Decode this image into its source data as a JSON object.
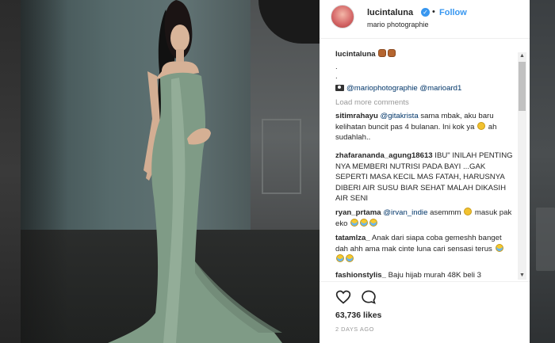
{
  "post": {
    "username": "lucintaluna",
    "follow_label": "Follow",
    "separator": "•",
    "location": "mario photographie",
    "caption_user": "lucintaluna",
    "dot1": ".",
    "dot2": ".",
    "tags": "@mariophotographie @marioard1",
    "load_more": "Load more comments"
  },
  "comments": [
    {
      "user": "sitimrahayu",
      "mention": "@gitakrista",
      "text_a": " sama mbak, aku baru kelihatan buncit pas 4 bulanan. Ini kok ya ",
      "text_b": " ah sudahlah.."
    },
    {
      "user": "zhafarananda_agung18613",
      "text_a": " IBU\" INILAH PENTING NYA MEMBERI NUTRISI PADA BAYI ...GAK SEPERTI MASA KECIL MAS FATAH, HARUSNYA DIBERI AIR SUSU BIAR SEHAT MALAH DIKASIH AIR SENI"
    },
    {
      "user": "ryan_prtama",
      "mention": "@irvan_indie",
      "text_a": " asemmm ",
      "text_b": " masuk pak eko "
    },
    {
      "user": "tatamlza_",
      "text_a": " Anak dari siapa coba gemeshh banget dah ahh ama mak cinte luna cari sensasi terus "
    },
    {
      "user": "fashionstylis_",
      "text_a": " Baju hijab murah 48K beli 3"
    }
  ],
  "footer": {
    "likes": "63,736 likes",
    "time": "2 DAYS AGO"
  },
  "icons": {
    "heart": "heart-icon",
    "comment": "comment-icon",
    "verified": "verified-badge-icon",
    "camera": "camera-icon"
  },
  "colors": {
    "link": "#3897f0",
    "mention": "#003569",
    "muted": "#999999"
  }
}
